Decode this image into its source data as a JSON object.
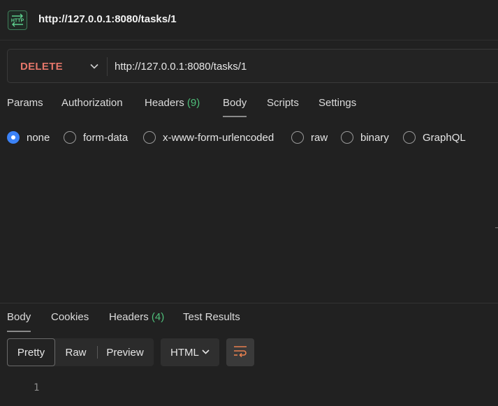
{
  "tab": {
    "icon": "http-icon",
    "icon_text": "HTTP",
    "title": "http://127.0.0.1:8080/tasks/1"
  },
  "request": {
    "method": "DELETE",
    "url": "http://127.0.0.1:8080/tasks/1"
  },
  "request_tabs": [
    {
      "label": "Params"
    },
    {
      "label": "Authorization"
    },
    {
      "label": "Headers",
      "count": "(9)"
    },
    {
      "label": "Body"
    },
    {
      "label": "Scripts"
    },
    {
      "label": "Settings"
    }
  ],
  "active_request_tab": "Body",
  "body_types": [
    {
      "label": "none",
      "checked": true
    },
    {
      "label": "form-data",
      "checked": false
    },
    {
      "label": "x-www-form-urlencoded",
      "checked": false
    },
    {
      "label": "raw",
      "checked": false
    },
    {
      "label": "binary",
      "checked": false
    },
    {
      "label": "GraphQL",
      "checked": false
    }
  ],
  "response_tabs": [
    {
      "label": "Body"
    },
    {
      "label": "Cookies"
    },
    {
      "label": "Headers",
      "count": "(4)"
    },
    {
      "label": "Test Results"
    }
  ],
  "active_response_tab": "Body",
  "response_view": {
    "modes": [
      "Pretty",
      "Raw",
      "Preview"
    ],
    "selected": "Pretty",
    "language": "HTML",
    "wrap_icon": "wrap-lines-icon"
  },
  "editor": {
    "line_numbers": [
      "1"
    ]
  },
  "colors": {
    "method_delete": "#e5766a",
    "count": "#4fbf7a",
    "radio_checked": "#3b82f6",
    "wrap_icon": "#e8804f",
    "http_icon": "#5fd08f"
  }
}
